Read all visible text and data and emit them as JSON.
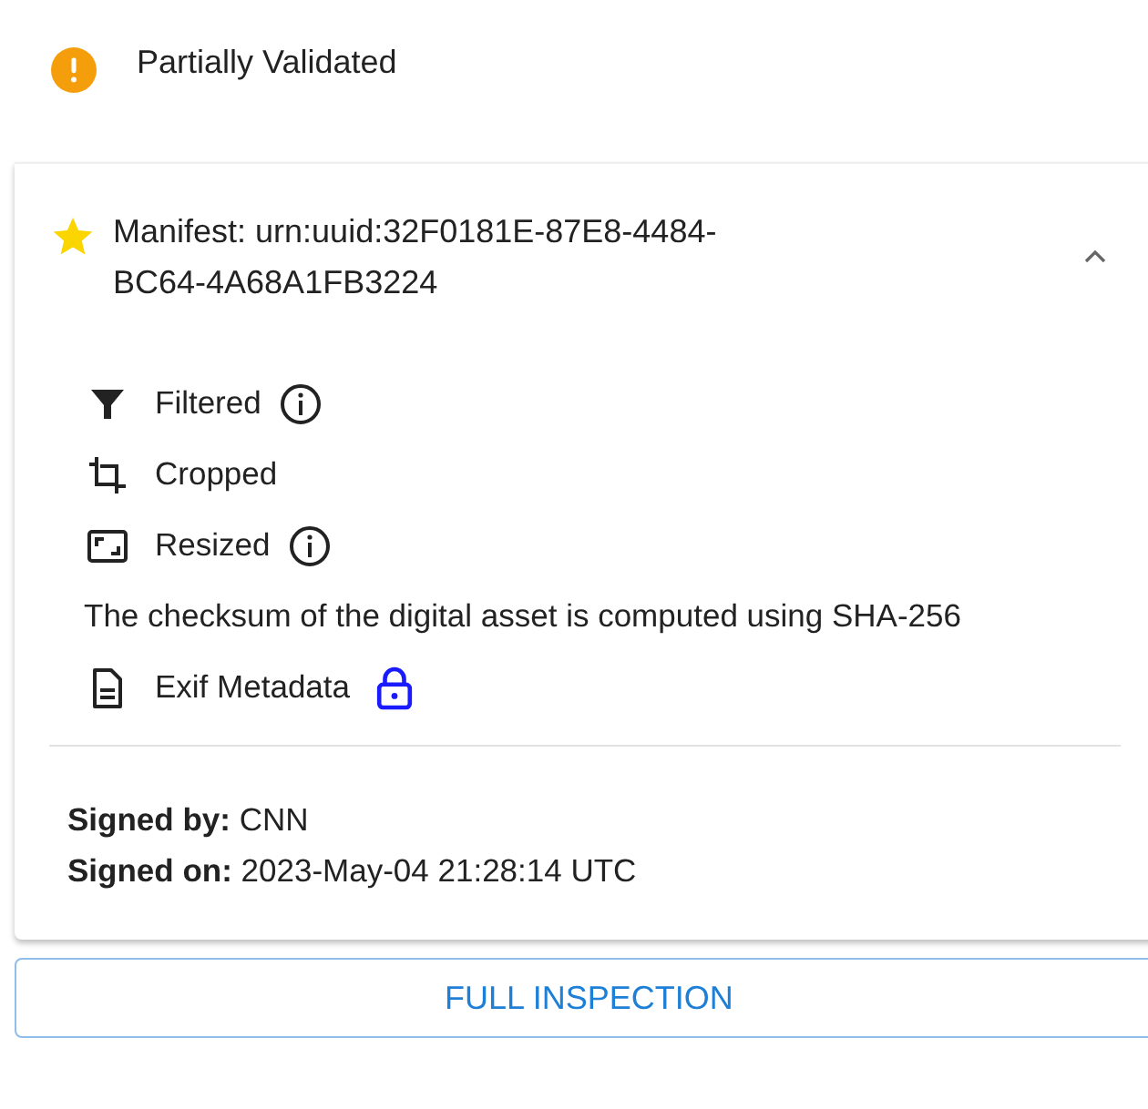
{
  "status": {
    "label": "Partially Validated",
    "kind": "warning"
  },
  "manifest": {
    "title": "Manifest: urn:uuid:32F0181E-87E8-4484-BC64-4A68A1FB3224",
    "expanded": true,
    "assertions": [
      {
        "kind": "filter",
        "label": "Filtered",
        "info": true,
        "locked": false
      },
      {
        "kind": "crop",
        "label": "Cropped",
        "info": false,
        "locked": false
      },
      {
        "kind": "resize",
        "label": "Resized",
        "info": true,
        "locked": false
      },
      {
        "kind": "text",
        "label": "The checksum of the digital asset is computed using SHA-256",
        "info": false,
        "locked": false
      },
      {
        "kind": "document",
        "label": "Exif Metadata",
        "info": false,
        "locked": true
      }
    ],
    "signature": [
      {
        "label": "Signed by:",
        "value": "CNN"
      },
      {
        "label": "Signed on:",
        "value": "2023-May-04 21:28:14 UTC"
      }
    ]
  },
  "button": "FULL INSPECTION"
}
